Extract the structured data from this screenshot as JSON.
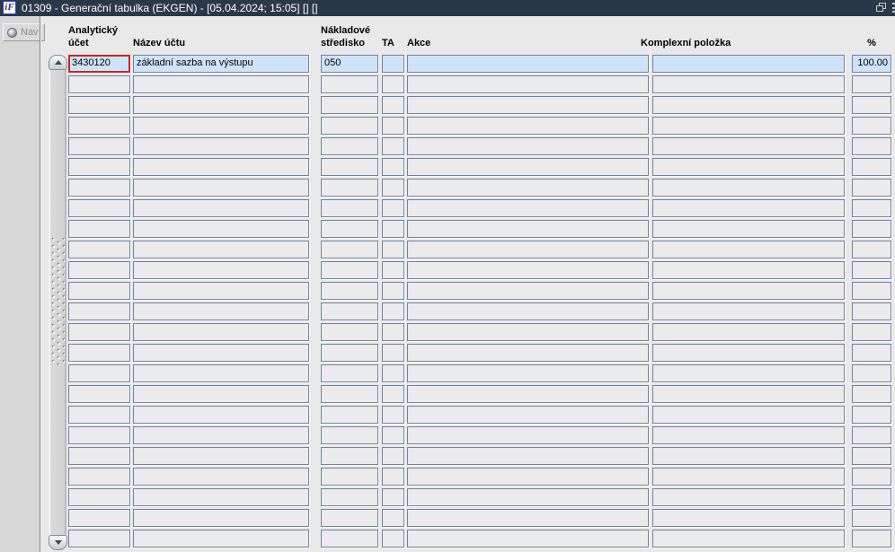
{
  "window": {
    "title": "01309 - Generační tabulka (EKGEN) - [05.04.2024; 15:05] [] []",
    "icon_i": "i",
    "icon_f": "F"
  },
  "sidebar": {
    "nav_label": "Nav"
  },
  "table": {
    "columns": [
      {
        "label": "Analytický\núčet"
      },
      {
        "label": "Název účtu"
      },
      {
        "label": "Nákladové\nstředisko"
      },
      {
        "label": "TA"
      },
      {
        "label": "Akce"
      },
      {
        "label": "Komplexní položka"
      },
      {
        "label": "%"
      }
    ],
    "rows": [
      {
        "analyticky_ucet": "3430120",
        "nazev_uctu": "základní sazba na výstupu",
        "nakladove_stredisko": "050",
        "ta": "",
        "akce": "",
        "komplexni_polozka": "",
        "percent": "100.00"
      }
    ],
    "empty_row_count": 23
  },
  "colors": {
    "titlebar": "#2a3849",
    "row_highlight": "#cde4f8",
    "focus_border": "#cd2222",
    "cell_border": "#73829b",
    "canvas": "#e9e9e9"
  }
}
